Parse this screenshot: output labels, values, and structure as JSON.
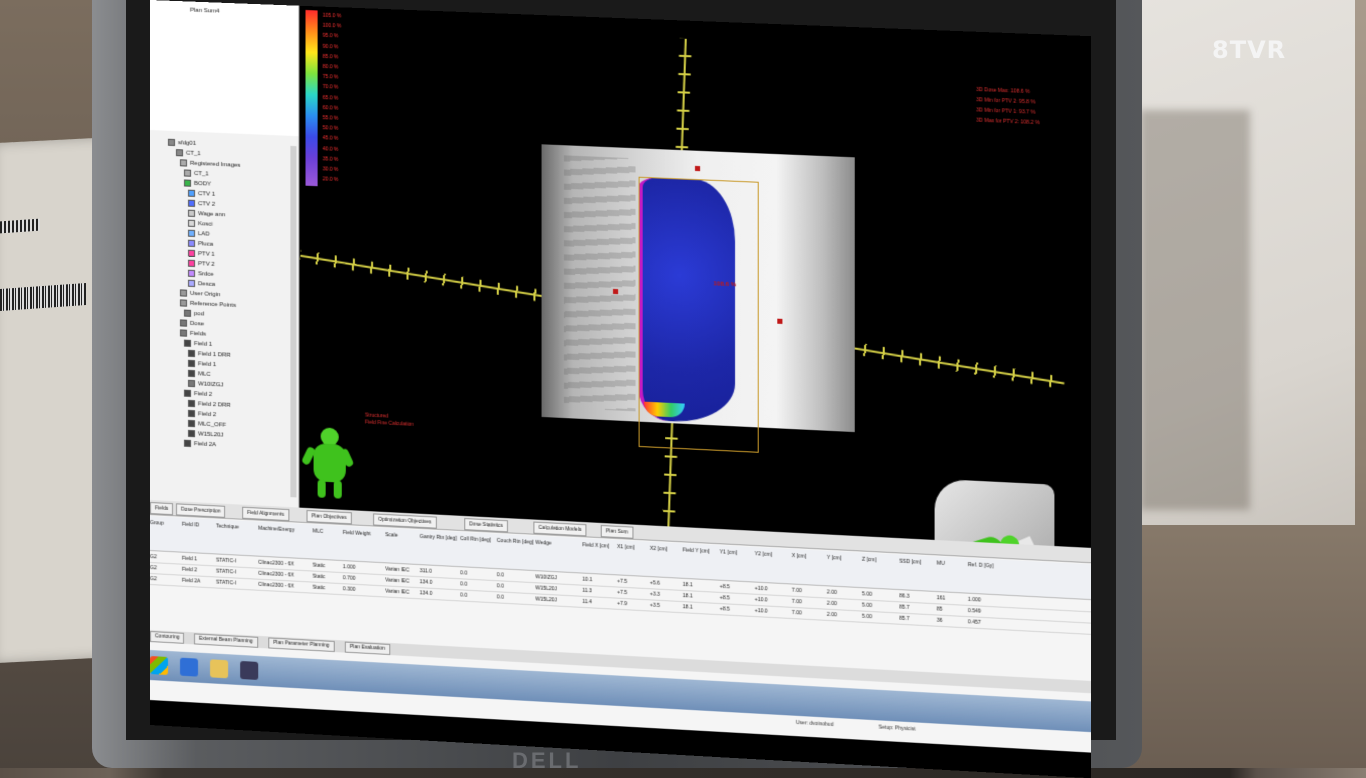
{
  "logo": {
    "text": "8TVR"
  },
  "monitor": {
    "brand": "DELL"
  },
  "tree": {
    "top_items": [
      "Plan Sum4"
    ],
    "items": [
      "sfdg01",
      "CT_1",
      "Registered Images",
      "CT_1",
      "BODY",
      "CTV 1",
      "CTV 2",
      "Wage ann",
      "Kosci",
      "LAD",
      "Pluca",
      "PTV 1",
      "PTV 2",
      "Srdce",
      "Desca",
      "User Origin",
      "Reference Points",
      "pod",
      "Dose",
      "Fields",
      "Field 1",
      "Field 1 DRR",
      "Field 1",
      "MLC",
      "W10IZGJ",
      "Field 2",
      "Field 2 DRR",
      "Field 2",
      "MLC_OFF",
      "W15L20J",
      "Field 2A"
    ]
  },
  "colorbar": {
    "labels": [
      "105.0 %",
      "100.0 %",
      "95.0 %",
      "90.0 %",
      "85.0 %",
      "80.0 %",
      "75.0 %",
      "70.0 %",
      "65.0 %",
      "60.0 %",
      "55.0 %",
      "50.0 %",
      "45.0 %",
      "40.0 %",
      "35.0 %",
      "30.0 %",
      "20.0 %"
    ]
  },
  "viewer": {
    "dose_max_label": "108.6 %",
    "info_lines": [
      "3D Dose Max: 108.6 %",
      "3D Min for PTV 2: 95.8 %",
      "3D Min for PTV 1: 93.7 %",
      "3D Max for PTV 2: 108.2 %"
    ],
    "note_lines": [
      "Structured",
      "Field Fine Calculation"
    ]
  },
  "bottom": {
    "tabs": [
      "Fields",
      "Dose Prescription",
      "Field Alignments",
      "Plan Objectives",
      "Optimization Objectives",
      "Dose Statistics",
      "Calculation Models",
      "Plan Sum"
    ],
    "headers": [
      "Group",
      "Field ID",
      "Technique",
      "Machine/Energy",
      "MLC",
      "Field Weight",
      "Scale",
      "Gantry Rtn [deg]",
      "Coll Rtn [deg]",
      "Couch Rtn [deg]",
      "Wedge",
      "Field X [cm]",
      "X1 [cm]",
      "X2 [cm]",
      "Field Y [cm]",
      "Y1 [cm]",
      "Y2 [cm]",
      "X [cm]",
      "Y [cm]",
      "Z [cm]",
      "SSD [cm]",
      "MU",
      "Ref. D [Gy]"
    ],
    "rows": [
      [
        "G2",
        "Field 1",
        "STATIC-I",
        "Clinac2300 - 6X",
        "Static",
        "1.000",
        "Varian IEC",
        "311.0",
        "0.0",
        "0.0",
        "W10IZGJ",
        "10.1",
        "+7.5",
        "+5.6",
        "18.1",
        "+8.5",
        "+10.0",
        "7.00",
        "2.00",
        "5.00",
        "86.3",
        "161",
        "1.000"
      ],
      [
        "G2",
        "Field 2",
        "STATIC-I",
        "Clinac2300 - 6X",
        "Static",
        "0.700",
        "Varian IEC",
        "134.0",
        "0.0",
        "0.0",
        "W15L20J",
        "11.3",
        "+7.5",
        "+3.3",
        "18.1",
        "+8.5",
        "+10.0",
        "7.00",
        "2.00",
        "5.00",
        "85.7",
        "85",
        "0.549"
      ],
      [
        "G2",
        "Field 2A",
        "STATIC-I",
        "Clinac2300 - 6X",
        "Static",
        "0.300",
        "Varian IEC",
        "134.0",
        "0.0",
        "0.0",
        "W15L20J",
        "11.4",
        "+7.9",
        "+3.5",
        "18.1",
        "+8.5",
        "+10.0",
        "7.00",
        "2.00",
        "5.00",
        "85.7",
        "36",
        "0.457"
      ]
    ],
    "bottom_tabs": [
      "Contouring",
      "External Beam Planning",
      "Plan Parameter Planning",
      "Plan Evaluation"
    ],
    "status_left": "User: dvoinobud",
    "status_right": "Setup: Physicist"
  },
  "colors": {
    "accent_crosshair": "#d4cf46",
    "ptv_blue": "#1d27a8",
    "dose_red": "#e03030",
    "patient_green": "#3fc21d"
  }
}
